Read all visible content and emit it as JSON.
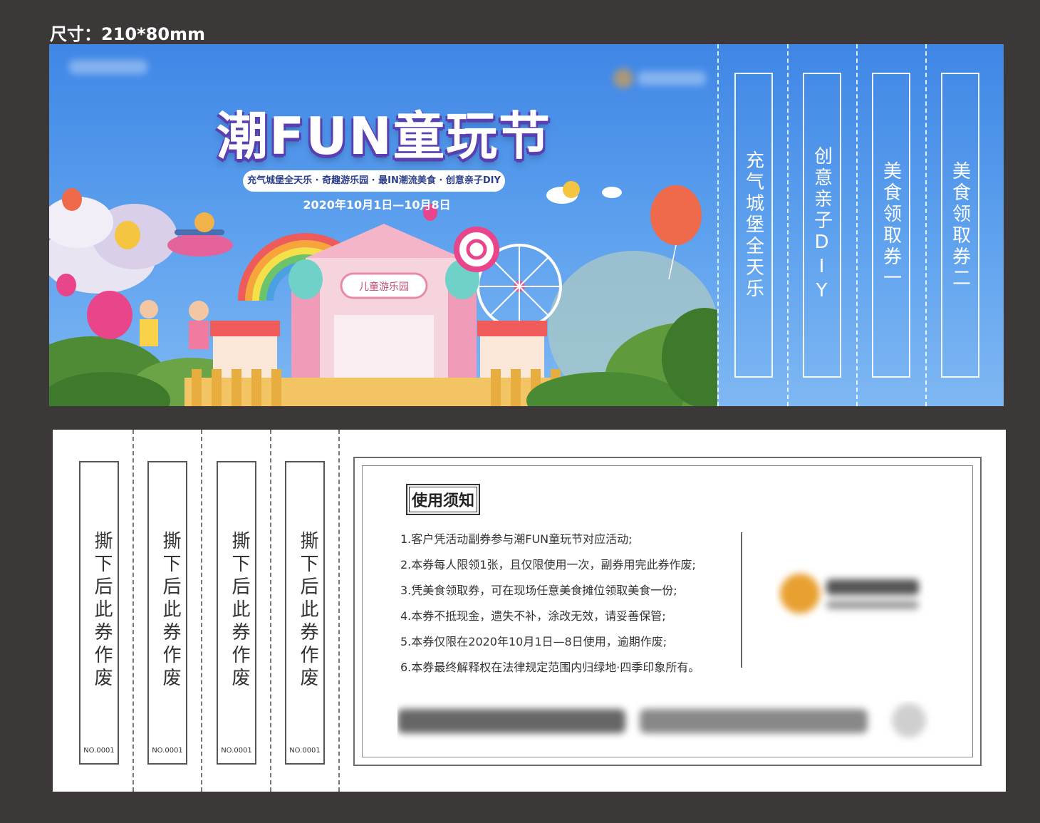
{
  "size_label": "尺寸：210*80mm",
  "front": {
    "title": "潮FUN童玩节",
    "tagline": "充气城堡全天乐 · 奇趣游乐园 · 最IN潮流美食 · 创意亲子DIY",
    "dates": "2020年10月1日—10月8日",
    "stubs": [
      "充气城堡全天乐",
      "创意亲子DIY",
      "美食领取券一",
      "美食领取券二"
    ]
  },
  "back": {
    "stubs": [
      {
        "text": "撕下后此券作废",
        "no": "NO.0001"
      },
      {
        "text": "撕下后此券作废",
        "no": "NO.0001"
      },
      {
        "text": "撕下后此券作废",
        "no": "NO.0001"
      },
      {
        "text": "撕下后此券作废",
        "no": "NO.0001"
      }
    ],
    "notice_title": "使用须知",
    "rules": [
      "1.客户凭活动副券参与潮FUN童玩节对应活动;",
      "2.本券每人限领1张，且仅限使用一次，副券用完此券作废;",
      "3.凭美食领取券，可在现场任意美食摊位领取美食一份;",
      "4.本券不抵现金，遗失不补，涂改无效，请妥善保管;",
      "5.本券仅限在2020年10月1日—8日使用，逾期作废;",
      "6.本券最终解释权在法律规定范围内归绿地·四季印象所有。"
    ]
  },
  "colors": {
    "sky": "#3f86e6",
    "title_shadow": "#5a3fb2",
    "background": "#3c3838"
  }
}
